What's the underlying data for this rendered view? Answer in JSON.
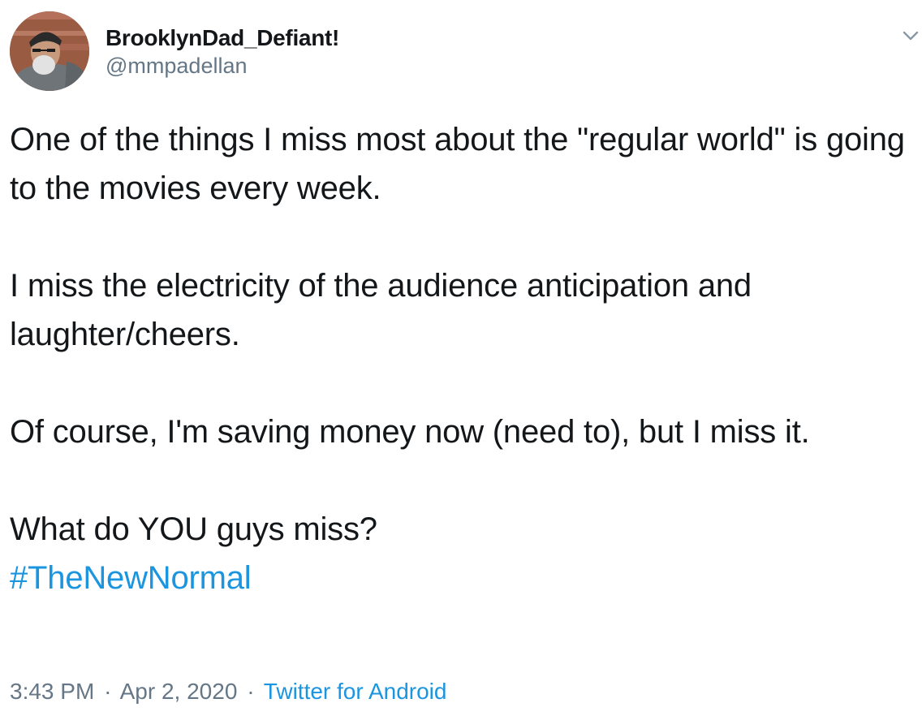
{
  "user": {
    "display_name": "BrooklynDad_Defiant!",
    "handle": "@mmpadellan"
  },
  "tweet": {
    "lines": [
      "One of the things I miss most about the \"regular world\" is going to the movies every week.",
      "I miss the electricity of the audience anticipation and laughter/cheers.",
      "Of course, I'm saving money now (need to), but I miss it.",
      "What do YOU guys miss?"
    ],
    "hashtag": "#TheNewNormal"
  },
  "meta": {
    "time": "3:43 PM",
    "separator": "·",
    "date": "Apr 2, 2020",
    "source": "Twitter for Android"
  },
  "icons": {
    "avatar": "avatar-photo",
    "menu": "chevron-down-icon"
  },
  "colors": {
    "text": "#14171a",
    "secondary": "#657786",
    "link": "#1b95e0"
  }
}
